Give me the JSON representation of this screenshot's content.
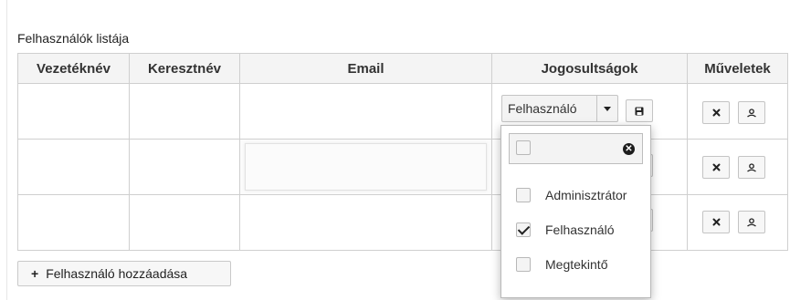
{
  "section_title": "Felhasználók listája",
  "table": {
    "columns": [
      "Vezetéknév",
      "Keresztnév",
      "Email",
      "Jogosultságok",
      "Műveletek"
    ],
    "rows": [
      {
        "lastname": "",
        "firstname": "",
        "email": "",
        "role": "Felhasználó"
      },
      {
        "lastname": "",
        "firstname": "",
        "email": "",
        "role": ""
      },
      {
        "lastname": "",
        "firstname": "",
        "email": "",
        "role": ""
      }
    ]
  },
  "add_button": {
    "icon": "+",
    "label": "Felhasználó hozzáadása"
  },
  "role_dropdown": {
    "selected": "Felhasználó",
    "search_value": "",
    "options": [
      {
        "label": "Adminisztrátor",
        "checked": false
      },
      {
        "label": "Felhasználó",
        "checked": true
      },
      {
        "label": "Megtekintő",
        "checked": false
      }
    ]
  },
  "icons": {
    "save": "floppy-disk-icon",
    "delete": "x-icon",
    "user": "user-icon",
    "clear": "clear-circle-icon",
    "caret": "caret-down-icon"
  }
}
